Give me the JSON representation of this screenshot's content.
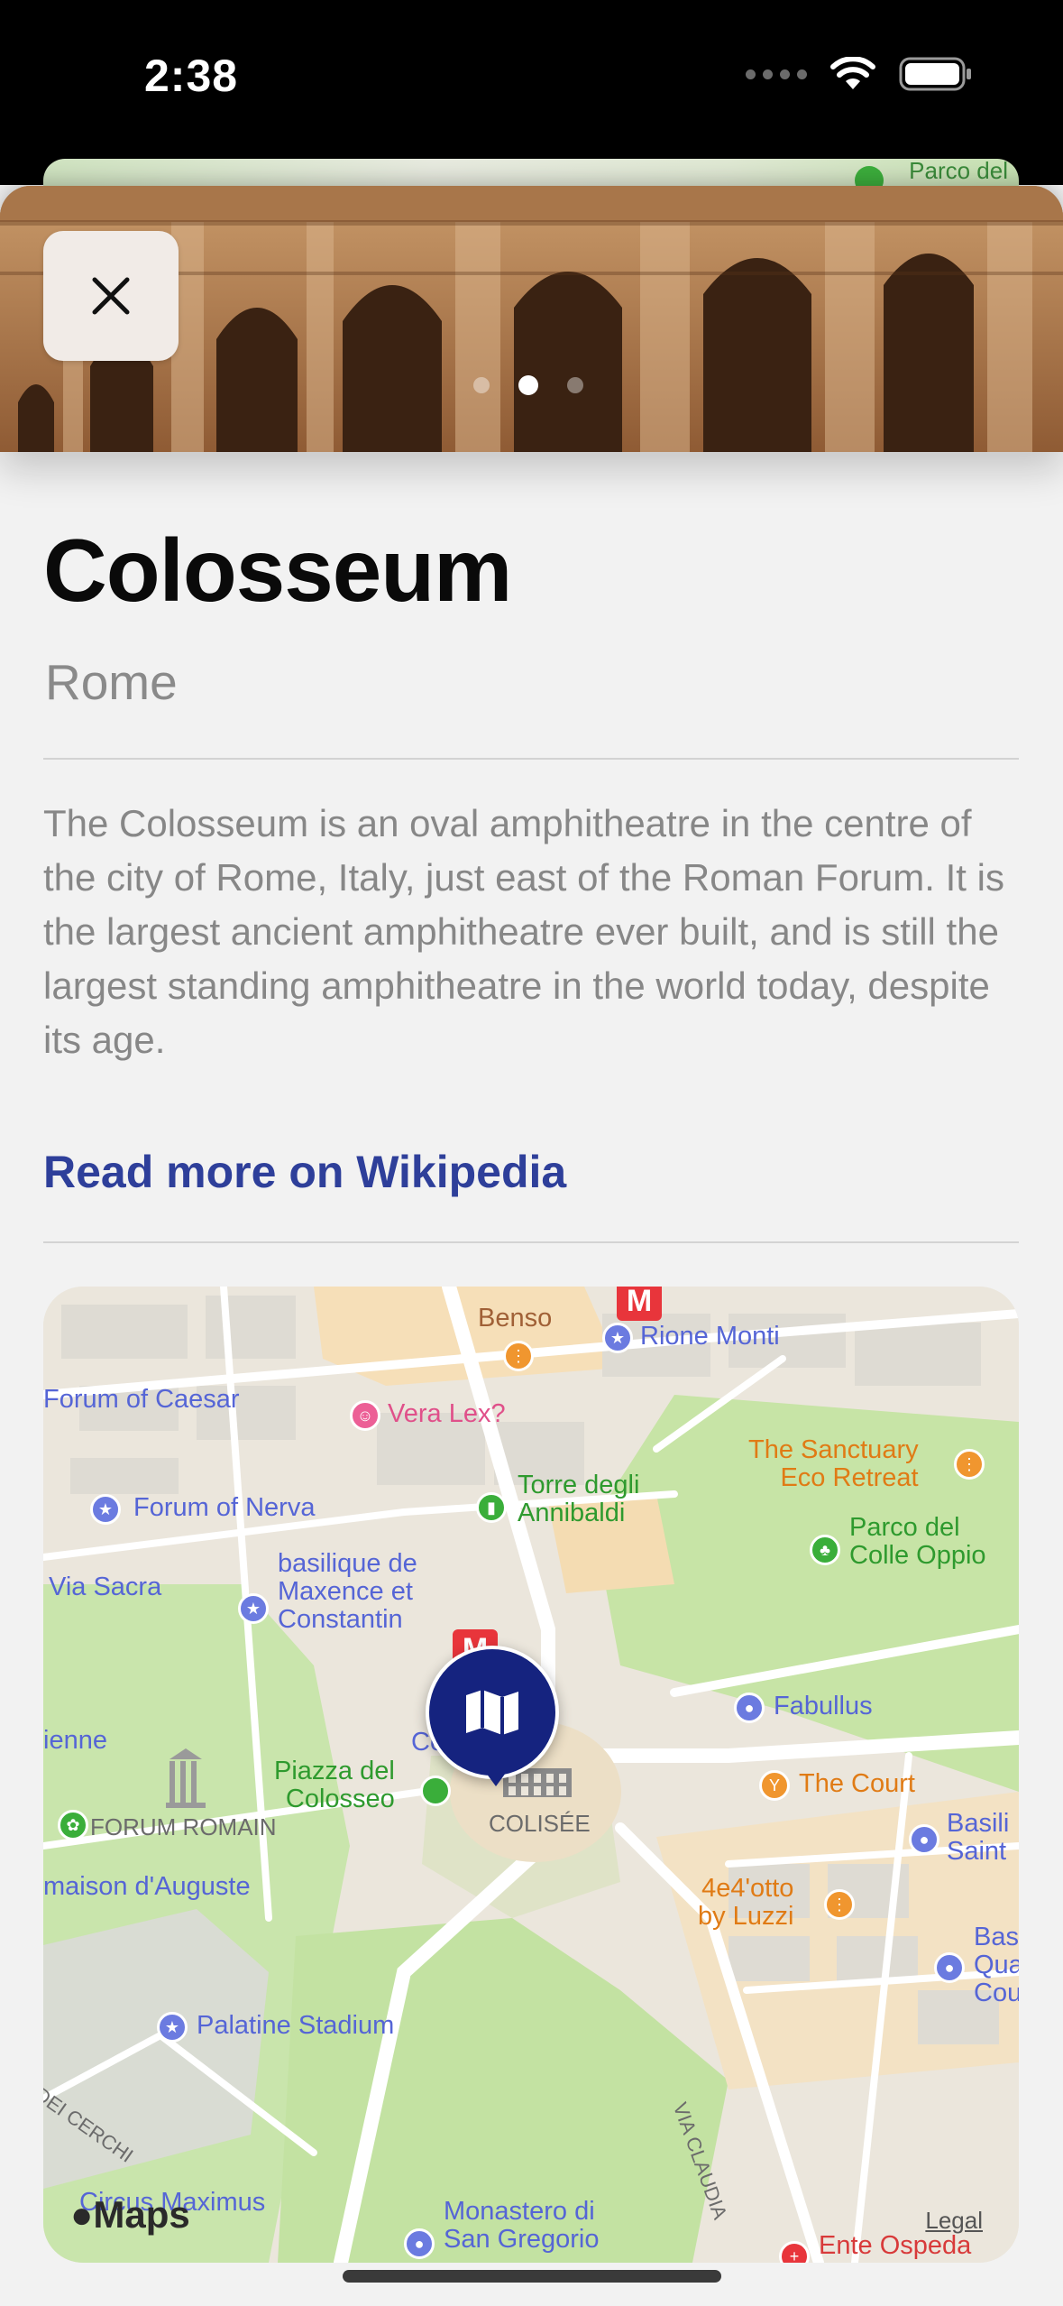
{
  "status_bar": {
    "time": "2:38"
  },
  "back_sheet": {
    "peek_label": "Parco del"
  },
  "hero": {
    "pager_total": 3,
    "pager_active": 2
  },
  "place": {
    "title": "Colosseum",
    "city": "Rome",
    "description": "The Colosseum is an oval amphitheatre in the centre of the city of Rome, Italy, just east of the Roman Forum. It is the largest ancient amphitheatre ever built, and is still the largest standing amphitheatre in the world today, despite its age.",
    "wiki_link": "Read more on Wikipedia"
  },
  "map": {
    "labels": {
      "benso": "Benso",
      "rione_monti": "Rione Monti",
      "forum_caesar": "Forum of Caesar",
      "vera_lex": "Vera Lex?",
      "sanctuary_1": "The Sanctuary",
      "sanctuary_2": "Eco Retreat",
      "forum_nerva": "Forum of Nerva",
      "torre_1": "Torre degli",
      "torre_2": "Annibaldi",
      "parco_1": "Parco del",
      "parco_2": "Colle Oppio",
      "via_sacra": "Via Sacra",
      "basilique_1": "basilique de",
      "basilique_2": "Maxence et",
      "basilique_3": "Constantin",
      "fabullus": "Fabullus",
      "ienne": "ienne",
      "colo": "Colo",
      "piazza_1": "Piazza del",
      "piazza_2": "Colosseo",
      "the_court": "The Court",
      "forum_romain": "FORUM ROMAIN",
      "colisee": "COLISÉE",
      "basili_1": "Basili",
      "basili_2": "Saint",
      "maison": "maison d'Auguste",
      "luzzi_1": "4e4'otto",
      "luzzi_2": "by Luzzi",
      "bas_1": "Bas",
      "bas_2": "Qua",
      "bas_3": "Cou",
      "palatine": "Palatine Stadium",
      "via_claudia": "VIA CLAUDIA",
      "dei_cerchi": "DEI CERCHI",
      "circus": "Circus Maximus",
      "monastero_1": "Monastero di",
      "monastero_2": "San Gregorio",
      "ente": "Ente Ospeda",
      "metro_letter": "M"
    },
    "maps_brand": "Maps",
    "legal": "Legal"
  }
}
